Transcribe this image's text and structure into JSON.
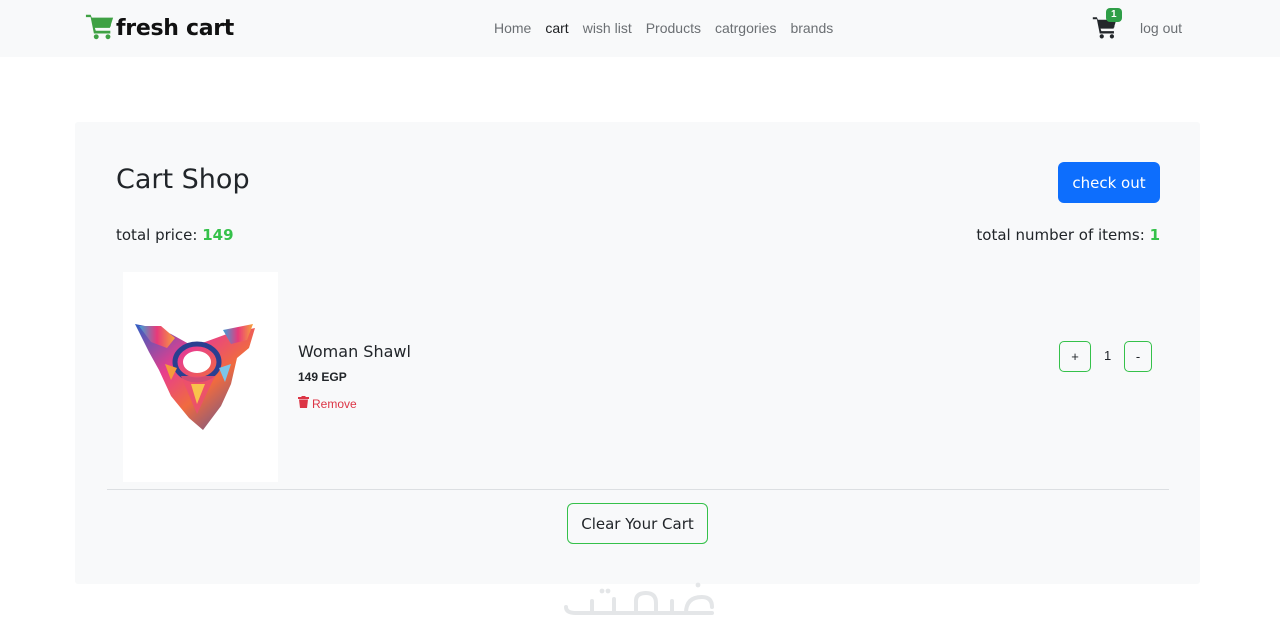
{
  "navbar": {
    "brand": "fresh cart",
    "links": [
      "Home",
      "cart",
      "wish list",
      "Products",
      "catrgories",
      "brands"
    ],
    "cart_badge": "1",
    "logout": "log out"
  },
  "cart": {
    "title": "Cart Shop",
    "checkout_label": "check out",
    "total_price_label": "total price:",
    "total_price_value": "149",
    "total_items_label": "total number of items:",
    "total_items_value": "1",
    "items": [
      {
        "name": "Woman Shawl",
        "price": "149 EGP",
        "remove_label": "Remove",
        "quantity": "1",
        "plus_label": "+",
        "minus_label": "-"
      }
    ],
    "clear_label": "Clear Your Cart"
  },
  "colors": {
    "accent_green": "#35c14a",
    "primary_blue": "#0d6efd",
    "danger_red": "#dc3545"
  },
  "icons": [
    "shopping-cart-icon",
    "trash-icon"
  ]
}
